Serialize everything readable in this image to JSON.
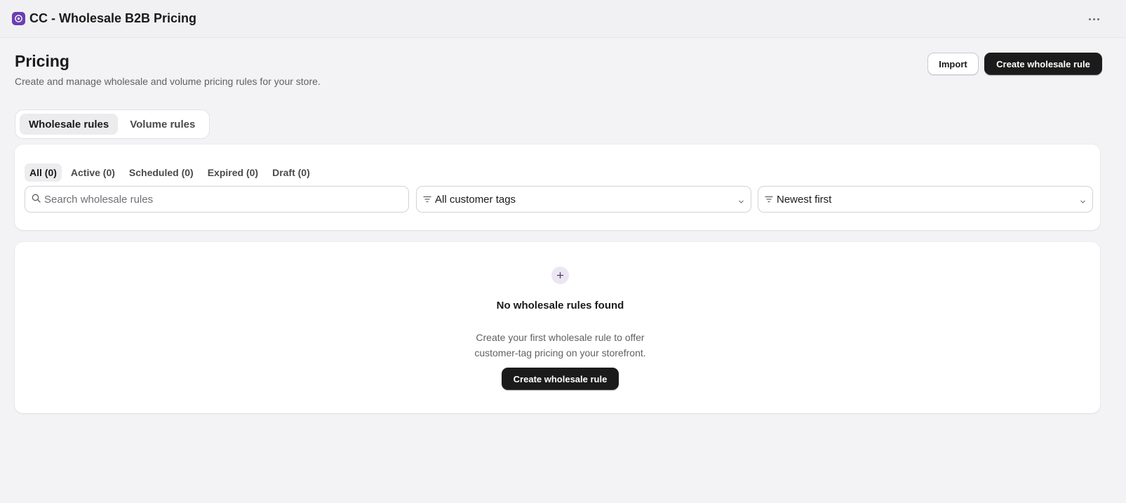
{
  "app": {
    "title": "CC - Wholesale B2B Pricing",
    "logo_icon": "app-logo-icon",
    "more_icon": "more-horizontal-icon"
  },
  "page": {
    "title": "Pricing",
    "subtitle": "Create and manage wholesale and volume pricing rules for your store."
  },
  "actions": {
    "import_label": "Import",
    "create_label": "Create wholesale rule"
  },
  "tabs": [
    {
      "label": "Wholesale rules",
      "active": true
    },
    {
      "label": "Volume rules",
      "active": false
    }
  ],
  "status_filters": [
    {
      "label": "All (0)",
      "active": true
    },
    {
      "label": "Active (0)",
      "active": false
    },
    {
      "label": "Scheduled (0)",
      "active": false
    },
    {
      "label": "Expired (0)",
      "active": false
    },
    {
      "label": "Draft (0)",
      "active": false
    }
  ],
  "search": {
    "placeholder": "Search wholesale rules",
    "value": "",
    "icon": "search-icon"
  },
  "filters": {
    "customer_tags": {
      "value": "All customer tags",
      "icon": "filter-lines-icon"
    },
    "sort": {
      "value": "Newest first",
      "icon": "filter-lines-icon"
    }
  },
  "empty_state": {
    "icon": "plus-icon",
    "title": "No wholesale rules found",
    "description_line1": "Create your first wholesale rule to offer",
    "description_line2": "customer-tag pricing on your storefront.",
    "button_label": "Create wholesale rule"
  },
  "colors": {
    "background": "#f3f3f6",
    "primary_button": "#1b1b1b",
    "brand": "#6b3fb0",
    "accent_soft": "#ece6f3"
  }
}
